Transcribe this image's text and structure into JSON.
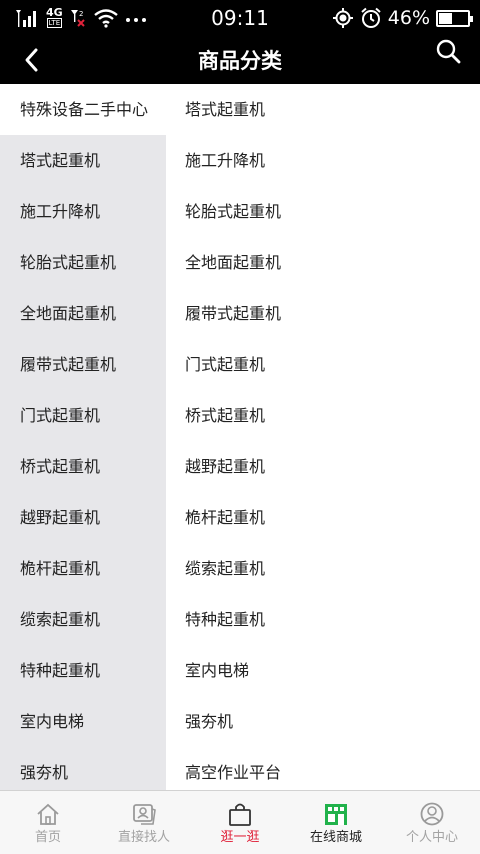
{
  "status_bar": {
    "network": "4G",
    "network_badge": "LTE",
    "time": "09:11",
    "battery_percent": "46%",
    "battery_level": 0.46
  },
  "header": {
    "title": "商品分类",
    "back_icon": "chevron-left-icon",
    "search_icon": "search-icon"
  },
  "categories": [
    "特殊设备二手中心",
    "塔式起重机",
    "施工升降机",
    "轮胎式起重机",
    "全地面起重机",
    "履带式起重机",
    "门式起重机",
    "桥式起重机",
    "越野起重机",
    "桅杆起重机",
    "缆索起重机",
    "特种起重机",
    "室内电梯",
    "强夯机"
  ],
  "subcategories": [
    "塔式起重机",
    "施工升降机",
    "轮胎式起重机",
    "全地面起重机",
    "履带式起重机",
    "门式起重机",
    "桥式起重机",
    "越野起重机",
    "桅杆起重机",
    "缆索起重机",
    "特种起重机",
    "室内电梯",
    "强夯机",
    "高空作业平台"
  ],
  "tabs": [
    {
      "label": "首页",
      "icon": "home-icon",
      "state": "normal"
    },
    {
      "label": "直接找人",
      "icon": "contacts-icon",
      "state": "normal"
    },
    {
      "label": "逛一逛",
      "icon": "shopping-bag-icon",
      "state": "highlight"
    },
    {
      "label": "在线商城",
      "icon": "store-icon",
      "state": "current"
    },
    {
      "label": "个人中心",
      "icon": "user-icon",
      "state": "normal"
    }
  ],
  "colors": {
    "header_bg": "#000000",
    "sidebar_bg": "#e7e7ea",
    "highlight_red": "#e0223a",
    "store_green": "#21b24b"
  }
}
